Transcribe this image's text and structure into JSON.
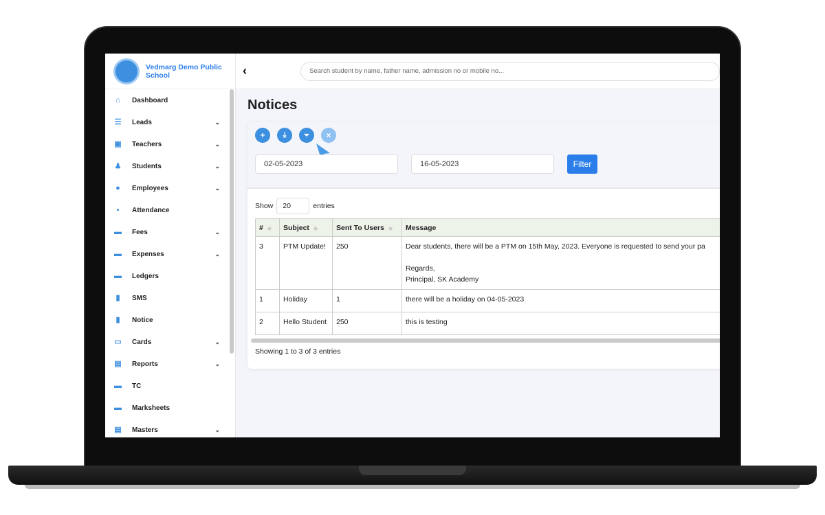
{
  "school_name": "Vedmarg Demo Public School",
  "logo_text": "Vedmarg",
  "sidebar": {
    "items": [
      {
        "label": "Dashboard",
        "icon": "home-icon",
        "glyph": "⌂",
        "expandable": false
      },
      {
        "label": "Leads",
        "icon": "list-icon",
        "glyph": "☰",
        "expandable": true
      },
      {
        "label": "Teachers",
        "icon": "teacher-icon",
        "glyph": "▣",
        "expandable": true
      },
      {
        "label": "Students",
        "icon": "student-icon",
        "glyph": "♟",
        "expandable": true
      },
      {
        "label": "Employees",
        "icon": "user-icon",
        "glyph": "●",
        "expandable": true
      },
      {
        "label": "Attendance",
        "icon": "id-card-icon",
        "glyph": "▪",
        "expandable": false
      },
      {
        "label": "Fees",
        "icon": "money-icon",
        "glyph": "▬",
        "expandable": true
      },
      {
        "label": "Expenses",
        "icon": "money-icon",
        "glyph": "▬",
        "expandable": true
      },
      {
        "label": "Ledgers",
        "icon": "money-icon",
        "glyph": "▬",
        "expandable": false
      },
      {
        "label": "SMS",
        "icon": "chat-icon",
        "glyph": "▮",
        "expandable": false
      },
      {
        "label": "Notice",
        "icon": "chat-icon",
        "glyph": "▮",
        "expandable": false
      },
      {
        "label": "Cards",
        "icon": "card-icon",
        "glyph": "▭",
        "expandable": true
      },
      {
        "label": "Reports",
        "icon": "excel-icon",
        "glyph": "▤",
        "expandable": true
      },
      {
        "label": "TC",
        "icon": "money-icon",
        "glyph": "▬",
        "expandable": false
      },
      {
        "label": "Marksheets",
        "icon": "money-icon",
        "glyph": "▬",
        "expandable": false
      },
      {
        "label": "Masters",
        "icon": "excel-icon",
        "glyph": "▤",
        "expandable": true
      }
    ]
  },
  "header": {
    "back": "‹",
    "search_placeholder": "Search student by name, father name, admission no or mobile no..."
  },
  "page_title": "Notices",
  "toolbar": {
    "add": "+",
    "download": "⤓",
    "filter": "⏷",
    "clear": "×"
  },
  "filters": {
    "from_date": "02-05-2023",
    "to_date": "16-05-2023",
    "filter_label": "Filter"
  },
  "table": {
    "show_label": "Show",
    "entries_value": "20",
    "entries_label": "entries",
    "columns": [
      "#",
      "Subject",
      "Sent To Users",
      "Message"
    ],
    "rows": [
      {
        "id": "3",
        "subject": "PTM Update!",
        "sent": "250",
        "message": "Dear students, there will be a PTM on 15th May, 2023. Everyone is requested to send your pa",
        "line2": "Regards,",
        "line3": "Principal, SK Academy"
      },
      {
        "id": "1",
        "subject": "Holiday",
        "sent": "1",
        "message": "there will be a holiday on 04-05-2023"
      },
      {
        "id": "2",
        "subject": "Hello Student",
        "sent": "250",
        "message": "this is testing"
      }
    ],
    "info": "Showing 1 to 3 of 3 entries"
  },
  "colors": {
    "accent": "#2b7de9",
    "button": "#3d8fe0"
  }
}
